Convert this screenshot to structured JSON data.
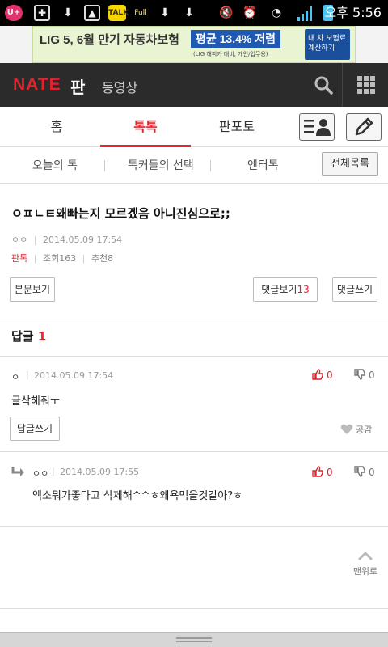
{
  "status_bar": {
    "time": "오후 5:56",
    "app_badge": "U+",
    "kakao_label": "TALK",
    "full_label": "Full"
  },
  "ad": {
    "headline": "LIG 5, 6월 만기 자동차보험",
    "badge": "평균 13.4% 저렴",
    "sub": "(LIG 해피카 대비, 개인/업무용)",
    "cta": "내 차 보험료 계산하기"
  },
  "header": {
    "logo": "NATE",
    "section": "판",
    "video": "동영상"
  },
  "tabs": [
    {
      "label": "홈"
    },
    {
      "label": "톡톡"
    },
    {
      "label": "판포토"
    }
  ],
  "subtabs": {
    "items": [
      {
        "label": "오늘의 톡"
      },
      {
        "label": "톡커들의 선택"
      },
      {
        "label": "엔터톡"
      }
    ],
    "all_button": "전체목록"
  },
  "post": {
    "title": "ㅇㅍㄴㅌ왜빠는지 모르겠음 아니진심으로;;",
    "author": "ㅇㅇ",
    "date": "2014.05.09 17:54",
    "category": "판톡",
    "views": "조회163",
    "recommend": "추천8",
    "view_body_button": "본문보기",
    "view_comments_label": "댓글보기",
    "view_comments_count": "13",
    "write_comment_button": "댓글쓰기"
  },
  "replies": {
    "header_label": "답글",
    "count": "1",
    "items": [
      {
        "author": "ㅇ",
        "date": "2014.05.09 17:54",
        "body": "글삭해줘ㅜ",
        "up": "0",
        "down": "0",
        "reply_button": "답글쓰기",
        "like_label": "공감"
      },
      {
        "author": "ㅇㅇ",
        "date": "2014.05.09 17:55",
        "body": "엑소뭐가좋다고 삭제해^^ㅎ왜욕먹을것같아?ㅎ",
        "up": "0",
        "down": "0"
      }
    ]
  },
  "to_top": "맨위로",
  "colors": {
    "accent": "#e3222b",
    "header_bg": "#2b2b2b"
  }
}
